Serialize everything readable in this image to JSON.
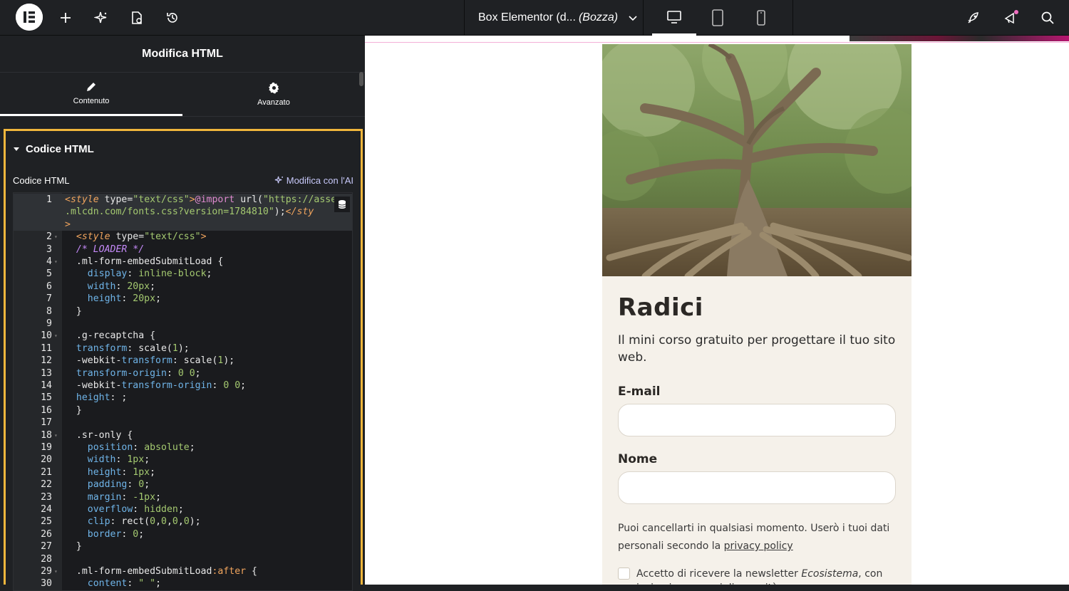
{
  "topbar": {
    "doc_title": "Box Elementor (d...",
    "doc_status": "(Bozza)"
  },
  "panel": {
    "title": "Modifica HTML",
    "tabs": [
      {
        "label": "Contenuto",
        "icon": "pencil-icon",
        "active": true
      },
      {
        "label": "Avanzato",
        "icon": "gear-icon",
        "active": false
      }
    ],
    "section_title": "Codice HTML",
    "field_label": "Codice HTML",
    "ai_link": "Modifica con l'AI"
  },
  "code_lines": [
    {
      "n": "1",
      "html": "<span class=\"c-tag\">&lt;style</span> <span class=\"c-attr\">type</span>=<span class=\"c-str\">\"text/css\"</span><span class=\"c-tag\">&gt;</span><span class=\"c-kw\">@import</span> url(<span class=\"c-str\">\"https://asse</span>"
    },
    {
      "n": "",
      "html": "<span class=\"c-str\">.mlcdn.com/fonts.css?version=1784810\"</span>);<span class=\"c-tag\">&lt;/sty</span>"
    },
    {
      "n": "",
      "html": "<span class=\"c-tag\">&gt;</span>"
    },
    {
      "n": "2",
      "html": "  <span class=\"c-tag\">&lt;style</span> <span class=\"c-attr\">type</span>=<span class=\"c-str\">\"text/css\"</span><span class=\"c-tag\">&gt;</span>"
    },
    {
      "n": "3",
      "html": "  <span class=\"c-cmt\">/* LOADER */</span>"
    },
    {
      "n": "4",
      "html": "  .ml-form-embedSubmitLoad {"
    },
    {
      "n": "5",
      "html": "    <span class=\"c-prop\">display</span>: <span class=\"c-str\">inline-block</span>;"
    },
    {
      "n": "6",
      "html": "    <span class=\"c-prop\">width</span>: <span class=\"c-num\">20px</span>;"
    },
    {
      "n": "7",
      "html": "    <span class=\"c-prop\">height</span>: <span class=\"c-num\">20px</span>;"
    },
    {
      "n": "8",
      "html": "  }"
    },
    {
      "n": "9",
      "html": ""
    },
    {
      "n": "10",
      "html": "  .g-recaptcha {"
    },
    {
      "n": "11",
      "html": "  <span class=\"c-prop\">transform</span>: scale(<span class=\"c-num\">1</span>);"
    },
    {
      "n": "12",
      "html": "  -webkit-<span class=\"c-prop\">transform</span>: scale(<span class=\"c-num\">1</span>);"
    },
    {
      "n": "13",
      "html": "  <span class=\"c-prop\">transform-origin</span>: <span class=\"c-num\">0 0</span>;"
    },
    {
      "n": "14",
      "html": "  -webkit-<span class=\"c-prop\">transform-origin</span>: <span class=\"c-num\">0 0</span>;"
    },
    {
      "n": "15",
      "html": "  <span class=\"c-prop\">height</span>: ;"
    },
    {
      "n": "16",
      "html": "  }"
    },
    {
      "n": "17",
      "html": ""
    },
    {
      "n": "18",
      "html": "  .sr-only {"
    },
    {
      "n": "19",
      "html": "    <span class=\"c-prop\">position</span>: <span class=\"c-str\">absolute</span>;"
    },
    {
      "n": "20",
      "html": "    <span class=\"c-prop\">width</span>: <span class=\"c-num\">1px</span>;"
    },
    {
      "n": "21",
      "html": "    <span class=\"c-prop\">height</span>: <span class=\"c-num\">1px</span>;"
    },
    {
      "n": "22",
      "html": "    <span class=\"c-prop\">padding</span>: <span class=\"c-num\">0</span>;"
    },
    {
      "n": "23",
      "html": "    <span class=\"c-prop\">margin</span>: <span class=\"c-num\">-1px</span>;"
    },
    {
      "n": "24",
      "html": "    <span class=\"c-prop\">overflow</span>: <span class=\"c-str\">hidden</span>;"
    },
    {
      "n": "25",
      "html": "    <span class=\"c-prop\">clip</span>: rect(<span class=\"c-num\">0</span>,<span class=\"c-num\">0</span>,<span class=\"c-num\">0</span>,<span class=\"c-num\">0</span>);"
    },
    {
      "n": "26",
      "html": "    <span class=\"c-prop\">border</span>: <span class=\"c-num\">0</span>;"
    },
    {
      "n": "27",
      "html": "  }"
    },
    {
      "n": "28",
      "html": ""
    },
    {
      "n": "29",
      "html": "  .ml-form-embedSubmitLoad<span class=\"c-pseudo\">:after</span> {"
    },
    {
      "n": "30",
      "html": "    <span class=\"c-prop\">content</span>: <span class=\"c-str\">\" \"</span>;"
    }
  ],
  "fold_lines": [
    "2",
    "4",
    "10",
    "18",
    "29"
  ],
  "preview": {
    "heading": "Radici",
    "subtitle": "Il mini corso gratuito per progettare il tuo sito web.",
    "email_label": "E-mail",
    "name_label": "Nome",
    "privacy_text": "Puoi cancellarti in qualsiasi momento. Userò i tuoi dati personali secondo la ",
    "privacy_link": "privacy policy",
    "newsletter_text_1": "Accetto di ricevere la newsletter ",
    "newsletter_name": "Ecosistema",
    "newsletter_text_2": ", con ispirazione, consigli e novità."
  },
  "colors": {
    "panel_bg": "#1f2124",
    "highlight_border": "#f0b63c",
    "card_bg": "#f5f1ea"
  }
}
